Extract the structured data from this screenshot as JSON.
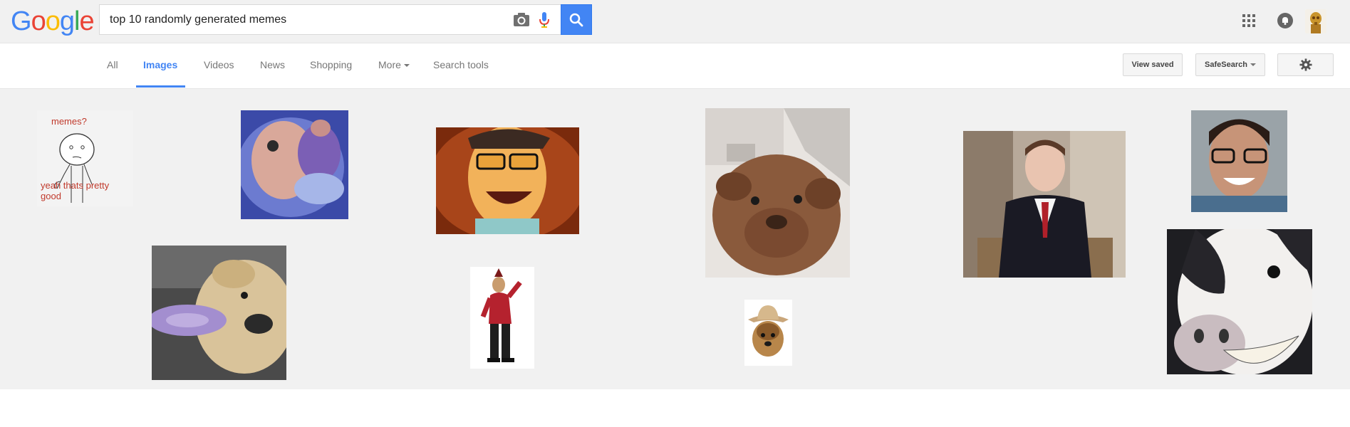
{
  "logo": {
    "letters": [
      "G",
      "o",
      "o",
      "g",
      "l",
      "e"
    ],
    "colors": [
      "#4285f4",
      "#ea4335",
      "#fbbc05",
      "#4285f4",
      "#34a853",
      "#ea4335"
    ]
  },
  "search": {
    "query": "top 10 randomly generated memes"
  },
  "icons": {
    "camera": "camera-icon",
    "mic": "mic-icon",
    "search": "search-icon",
    "apps": "apps-grid-icon",
    "notifications": "notification-bell-icon",
    "settings": "gear-icon"
  },
  "tabs": [
    {
      "label": "All"
    },
    {
      "label": "Images",
      "active": true
    },
    {
      "label": "Videos"
    },
    {
      "label": "News"
    },
    {
      "label": "Shopping"
    },
    {
      "label": "More"
    },
    {
      "label": "Search tools"
    }
  ],
  "toolbar": {
    "view_saved": "View saved",
    "safesearch": "SafeSearch"
  },
  "images": {
    "meme1_top": "memes?",
    "meme1_bottom_line1": "yeah thats pretty",
    "meme1_bottom_line2": "good"
  },
  "colors": {
    "accent": "#4285f4",
    "meme_text": "#c0392b"
  }
}
